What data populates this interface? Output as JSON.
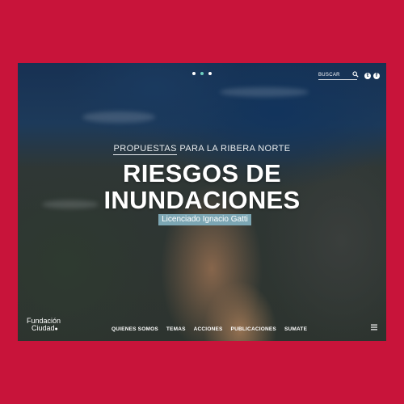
{
  "slider": {
    "dots": 3,
    "active_index": 1
  },
  "search": {
    "placeholder": "BUSCAR"
  },
  "social": {
    "twitter_glyph": "t",
    "facebook_glyph": "f"
  },
  "hero": {
    "subtitle_keyword": "PROPUESTAS",
    "subtitle_rest": " PARA LA RIBERA NORTE",
    "title_line1": "RIESGOS DE",
    "title_line2": "INUNDACIONES",
    "author": "Licenciado Ignacio Gatti"
  },
  "logo": {
    "line1": "Fundación",
    "line2": "Ciudad",
    "drop_glyph": "💧"
  },
  "nav": {
    "items": [
      "QUIENES SOMOS",
      "TEMAS",
      "ACCIONES",
      "PUBLICACIONES",
      "SUMATE"
    ]
  },
  "colors": {
    "frame": "#c8143a",
    "author_bg": "#7ca6b3",
    "active_dot": "#6dd0c0"
  }
}
